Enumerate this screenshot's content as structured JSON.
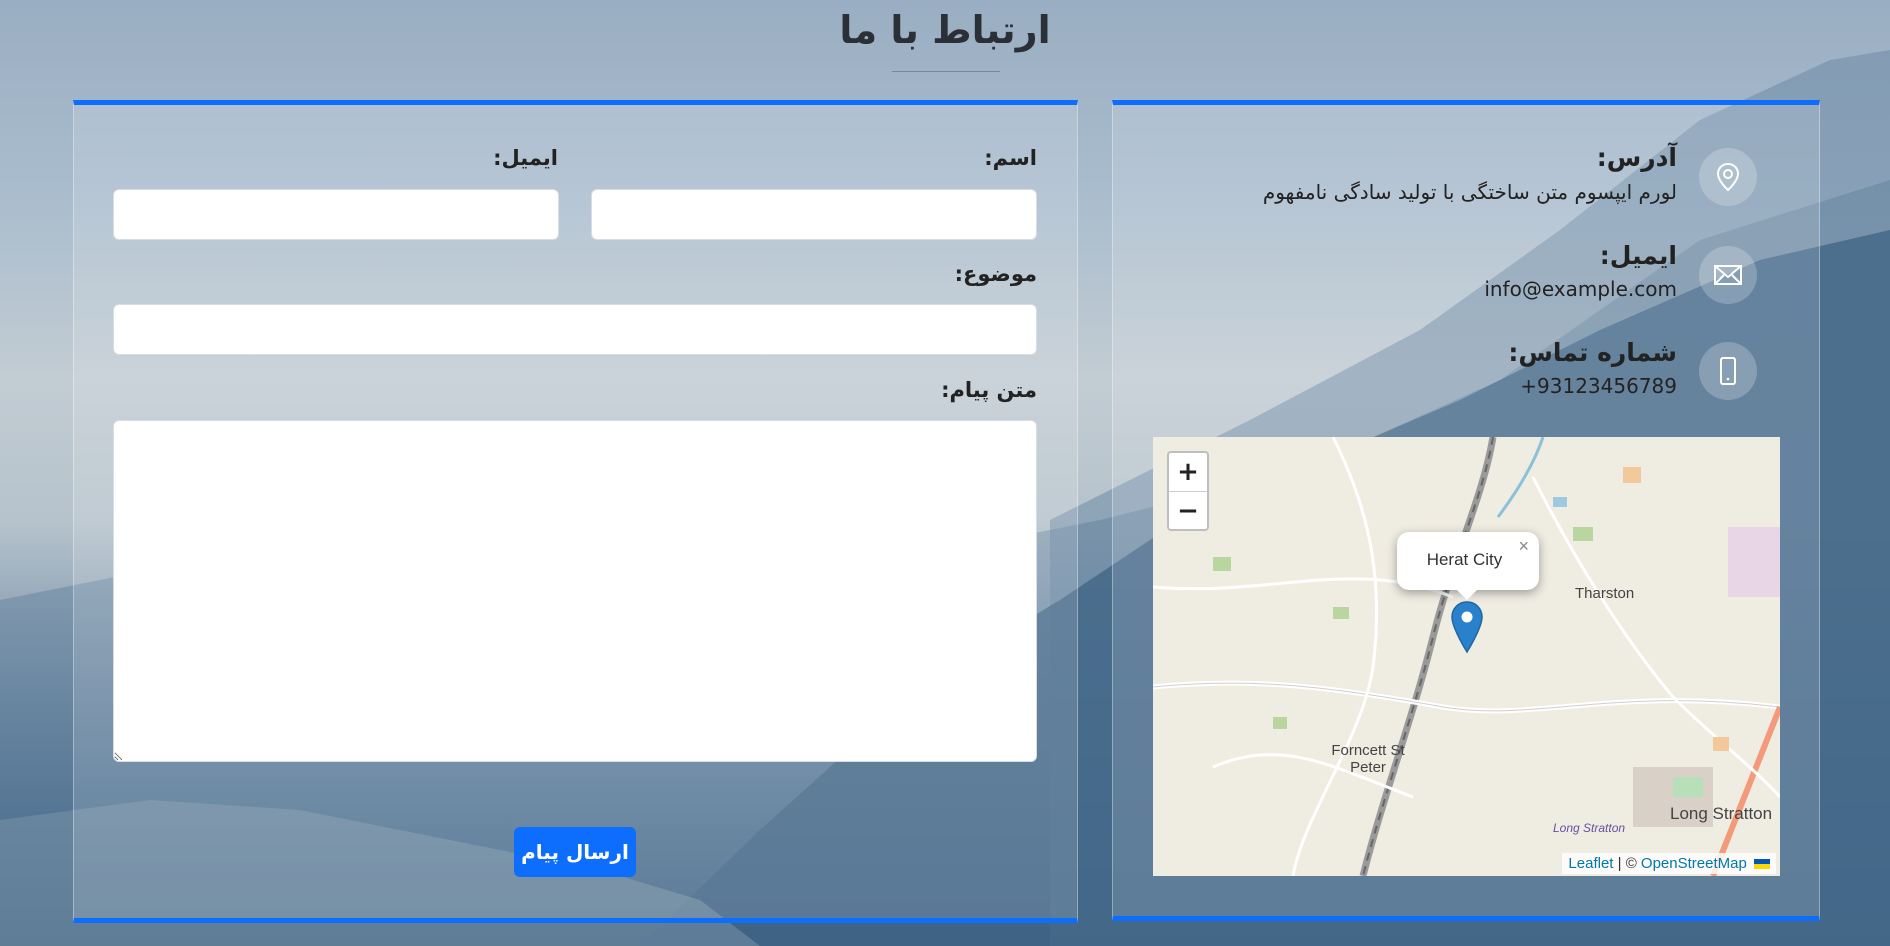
{
  "page": {
    "title": "ارتباط با ما"
  },
  "form": {
    "name_label": "اسم:",
    "email_label": "ایمیل:",
    "subject_label": "موضوع:",
    "message_label": "متن پیام:",
    "name_value": "",
    "email_value": "",
    "subject_value": "",
    "message_value": "",
    "submit_label": "ارسال پیام"
  },
  "contact": {
    "address_title": "آدرس:",
    "address_text": "لورم ایپسوم متن ساختگی با تولید سادگی نامفهوم",
    "email_title": "ایمیل:",
    "email_text": "info@example.com",
    "phone_title": "شماره تماس:",
    "phone_text": "93123456789+"
  },
  "map": {
    "zoom_in": "+",
    "zoom_out": "−",
    "popup_text": "Herat City",
    "popup_close": "×",
    "places": [
      "Tharston",
      "Forncett St Peter",
      "Long Stratton",
      "Long Stratton"
    ],
    "attribution_leaflet": "Leaflet",
    "attribution_sep": " | © ",
    "attribution_osm": "OpenStreetMap",
    "marker_color": "#2a81cb"
  },
  "colors": {
    "accent": "#0d6efd"
  },
  "icons": {
    "address": "map-pin-icon",
    "email": "envelope-icon",
    "phone": "mobile-phone-icon",
    "marker": "map-marker-icon"
  }
}
